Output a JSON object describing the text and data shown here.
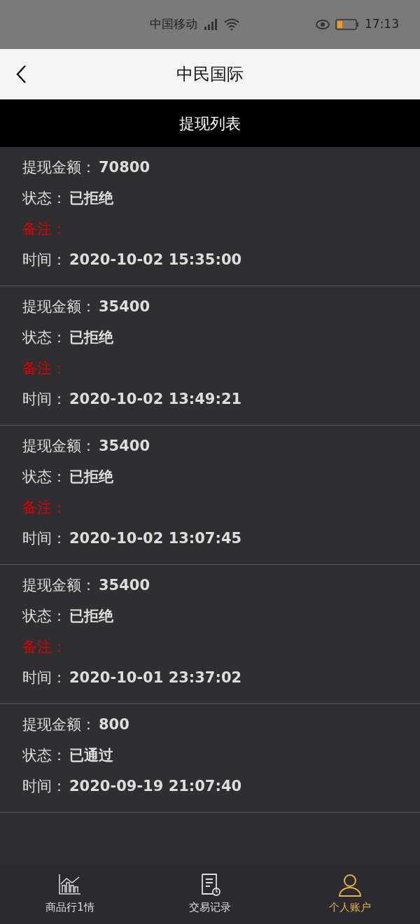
{
  "status_bar": {
    "carrier": "中国移动",
    "time": "17:13"
  },
  "header": {
    "title": "中民国际"
  },
  "section_title": "提现列表",
  "records": [
    {
      "lines": [
        {
          "kind": "field",
          "label": "提现金额：",
          "value": "70800"
        },
        {
          "kind": "field",
          "label": "状态：",
          "value": "已拒绝"
        },
        {
          "kind": "note",
          "label": "备注："
        },
        {
          "kind": "field",
          "label": "时间：",
          "value": "2020-10-02 15:35:00"
        }
      ]
    },
    {
      "lines": [
        {
          "kind": "field",
          "label": "提现金额：",
          "value": "35400"
        },
        {
          "kind": "field",
          "label": "状态：",
          "value": "已拒绝"
        },
        {
          "kind": "note",
          "label": "备注："
        },
        {
          "kind": "field",
          "label": "时间：",
          "value": "2020-10-02 13:49:21"
        }
      ]
    },
    {
      "lines": [
        {
          "kind": "field",
          "label": "提现金额：",
          "value": "35400"
        },
        {
          "kind": "field",
          "label": "状态：",
          "value": "已拒绝"
        },
        {
          "kind": "note",
          "label": "备注："
        },
        {
          "kind": "field",
          "label": "时间：",
          "value": "2020-10-02 13:07:45"
        }
      ]
    },
    {
      "lines": [
        {
          "kind": "field",
          "label": "提现金额：",
          "value": "35400"
        },
        {
          "kind": "field",
          "label": "状态：",
          "value": "已拒绝"
        },
        {
          "kind": "note",
          "label": "备注："
        },
        {
          "kind": "field",
          "label": "时间：",
          "value": "2020-10-01 23:37:02"
        }
      ]
    },
    {
      "lines": [
        {
          "kind": "field",
          "label": "提现金额：",
          "value": "800"
        },
        {
          "kind": "field",
          "label": "状态：",
          "value": "已通过"
        },
        {
          "kind": "field",
          "label": "时间：",
          "value": "2020-09-19 21:07:40"
        }
      ]
    }
  ],
  "bottom_nav": [
    {
      "kind": "chart",
      "label": "商品行1情",
      "selected": false
    },
    {
      "kind": "records",
      "label": "交易记录",
      "selected": false
    },
    {
      "kind": "account",
      "label": "个人账户",
      "selected": true
    }
  ]
}
